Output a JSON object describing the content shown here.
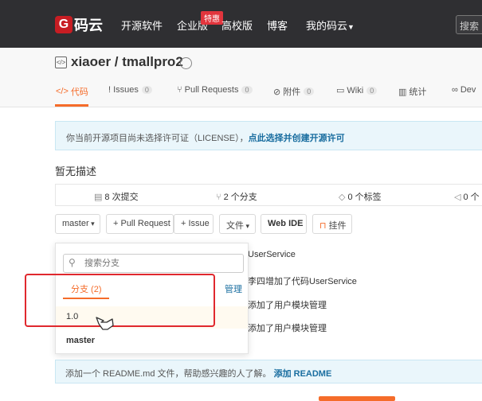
{
  "topbar": {
    "logo_letter": "G",
    "logo_text": "码云",
    "nav": [
      "开源软件",
      "企业版",
      "高校版",
      "博客",
      "我的码云"
    ],
    "badge": "特惠",
    "search_placeholder": "搜索"
  },
  "repo": {
    "title": "xiaoer / tmallpro2",
    "tabs": [
      {
        "icon": "</>",
        "label": "代码",
        "count": ""
      },
      {
        "icon": "!",
        "label": "Issues",
        "count": "0"
      },
      {
        "icon": "⑂",
        "label": "Pull Requests",
        "count": "0"
      },
      {
        "icon": "⊘",
        "label": "附件",
        "count": "0"
      },
      {
        "icon": "▭",
        "label": "Wiki",
        "count": "0"
      },
      {
        "icon": "▥",
        "label": "统计",
        "count": ""
      },
      {
        "icon": "∞",
        "label": "Dev",
        "count": ""
      }
    ]
  },
  "notice": {
    "text": "你当前开源项目尚未选择许可证（LICENSE），",
    "link": "点此选择并创建开源许可"
  },
  "description": "暂无描述",
  "stats": {
    "commits": "8 次提交",
    "branches": "2 个分支",
    "tags": "0 个标签",
    "releases": "0 个"
  },
  "toolbar": {
    "branch": "master",
    "pull_request": "+ Pull Request",
    "issue": "+ Issue",
    "file": "文件",
    "web_ide": "Web IDE",
    "pin": "挂件"
  },
  "file_rows": [
    "UserService",
    "李四增加了代码UserService",
    "添加了用户模块管理",
    "添加了用户模块管理"
  ],
  "dropdown": {
    "search_placeholder": "搜索分支",
    "tab_label": "分支 (2)",
    "manage_label": "管理",
    "branches": [
      "1.0",
      "master"
    ]
  },
  "readme": {
    "text": "添加一个 README.md 文件，帮助感兴趣的人了解。",
    "link": "添加 README"
  },
  "colors": {
    "accent": "#f56c2a",
    "topbar": "#2f2f32",
    "highlight": "#e0282e",
    "link": "#1a6ea0"
  }
}
